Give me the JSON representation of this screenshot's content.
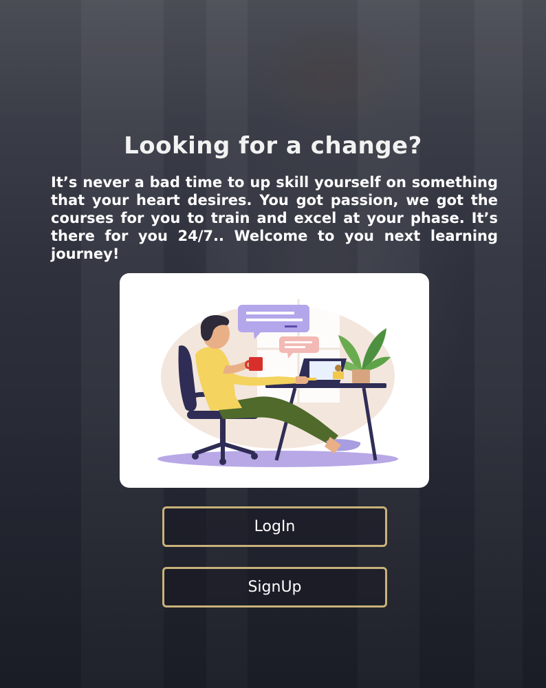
{
  "hero": {
    "title": "Looking for a change?",
    "description": "It’s never a bad time to up skill yourself on something that your heart desires. You got passion, we got the courses for you to train and excel at your phase. It’s there for you 24/7.. Welcome to you next learning journey!"
  },
  "illustration": {
    "icon": "person-working-at-laptop-illustration"
  },
  "actions": {
    "login_label": "LogIn",
    "signup_label": "SignUp"
  },
  "colors": {
    "button_border": "#c9b27a",
    "text": "#ffffff",
    "background": "#2e313c"
  }
}
